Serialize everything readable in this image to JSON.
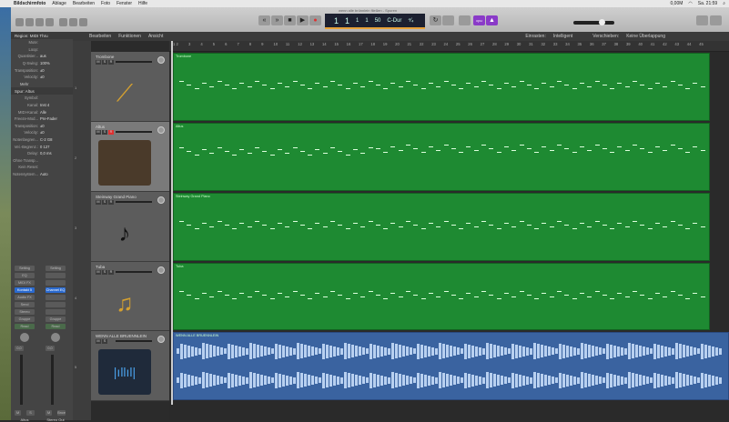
{
  "menubar": {
    "app": "Bildschirmfoto",
    "items": [
      "Ablage",
      "Bearbeiten",
      "Foto",
      "Fenster",
      "Hilfe"
    ],
    "status": {
      "memory": "0,00M",
      "clock": "Sa. 21:59"
    }
  },
  "window": {
    "title": "wenn alle brünnlein fließen - Spuren"
  },
  "lcd": {
    "bar": "1",
    "beat": "1",
    "div": "1",
    "tick": "1",
    "tempo": "50",
    "key": "C-Dur",
    "signature": "⁴⁄₄"
  },
  "lcd_badge": "cpu",
  "controlbar": {
    "edit": "Bearbeiten",
    "functions": "Funktionen",
    "view": "Ansicht",
    "snap_label": "Einrasten:",
    "snap_value": "Intelligent",
    "drag_label": "Verschieben:",
    "drag_value": "Keine Überlappung"
  },
  "inspector": {
    "region_header": "Region: MIDI Thru",
    "region_rows": [
      [
        "Mute:",
        ""
      ],
      [
        "Loop:",
        ""
      ],
      [
        "Quantisier...",
        "aus"
      ],
      [
        "Q-Swing:",
        "100%"
      ],
      [
        "Transposition:",
        "±0"
      ],
      [
        "Velocity:",
        "±0"
      ]
    ],
    "more": "Mehr",
    "track_header": "Spur: Altus",
    "track_rows": [
      [
        "Symbol:",
        ""
      ],
      [
        "Kanal:",
        "Inst 4"
      ],
      [
        "MIDI-Kanal:",
        "Alle"
      ],
      [
        "Freeze-Mod...",
        "Pre-Fader"
      ],
      [
        "Transposition:",
        "±0"
      ],
      [
        "Velocity:",
        "±0"
      ],
      [
        "Notenbegren...",
        "C-2   G8"
      ],
      [
        "Vel.-Begrenz.:",
        "0   127"
      ],
      [
        "Delay:",
        "0,0 ms"
      ],
      [
        "Ohne Transp...",
        ""
      ],
      [
        "Kein Reset:",
        ""
      ],
      [
        "Notensystem...",
        "Auto"
      ]
    ]
  },
  "mixer": [
    {
      "setting": "Setting",
      "eq": "EQ",
      "midifx": "MIDI FX",
      "plugin": "Kontakt 5",
      "audiofx": "Audio FX",
      "send": "Send",
      "output": "Stereo",
      "group": "Gruppe",
      "auto": "Read",
      "value": "0,0",
      "mute": "M",
      "solo": "S",
      "name": "Altus"
    },
    {
      "setting": "Setting",
      "eq": "",
      "midifx": "",
      "plugin": "Channel EQ",
      "audiofx": "",
      "send": "",
      "output": "",
      "group": "Gruppe",
      "auto": "Read",
      "value": "0,0",
      "mute": "M",
      "solo": "Bnce",
      "name": "Stereo Out"
    }
  ],
  "tracks": [
    {
      "num": "1",
      "name": "Trombone",
      "region": "Trombone",
      "msr": [
        "M",
        "S",
        "R"
      ]
    },
    {
      "num": "2",
      "name": "Altus",
      "region": "Altus",
      "msr": [
        "M",
        "S",
        "R"
      ]
    },
    {
      "num": "3",
      "name": "Steinway Grand Piano",
      "region": "Steinway Grand Piano",
      "msr": [
        "M",
        "S",
        "R"
      ]
    },
    {
      "num": "4",
      "name": "Tuba",
      "region": "Tuba",
      "msr": [
        "M",
        "S",
        "R"
      ]
    },
    {
      "num": "5",
      "name": "WENN ALLE BRUENNLEIN",
      "region": "WENN ALLE BRUENNLEIN",
      "msr": [
        "M",
        "S"
      ]
    }
  ],
  "colors": {
    "midi_region": "#1e8a32",
    "audio_region": "#3a63a0",
    "record": "#e03030"
  }
}
